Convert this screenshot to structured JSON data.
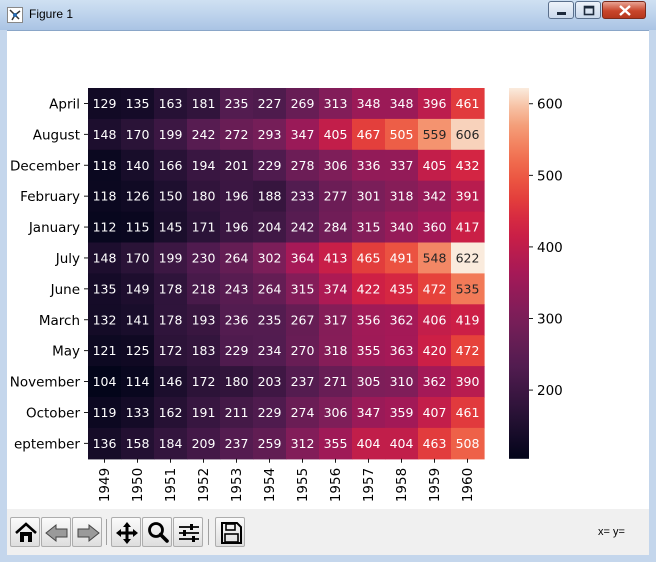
{
  "window": {
    "title": "Figure 1"
  },
  "toolbar": {
    "buttons": [
      {
        "name": "home",
        "icon": "home-icon"
      },
      {
        "name": "back",
        "icon": "back-arrow-icon"
      },
      {
        "name": "forward",
        "icon": "forward-arrow-icon"
      },
      {
        "name": "pan",
        "icon": "move-icon"
      },
      {
        "name": "zoom",
        "icon": "zoom-icon"
      },
      {
        "name": "configure-subplots",
        "icon": "sliders-icon"
      },
      {
        "name": "save",
        "icon": "save-icon"
      }
    ],
    "coords_x_label": "x=",
    "coords_y_label": "y="
  },
  "chart_data": {
    "type": "heatmap",
    "title": "",
    "xlabel": "",
    "ylabel": "",
    "x": [
      "1949",
      "1950",
      "1951",
      "1952",
      "1953",
      "1954",
      "1955",
      "1956",
      "1957",
      "1958",
      "1959",
      "1960"
    ],
    "y": [
      "April",
      "August",
      "December",
      "February",
      "January",
      "July",
      "June",
      "March",
      "May",
      "November",
      "October",
      "September"
    ],
    "y_tick_labels_shown": [
      "April",
      "August",
      "December",
      "February",
      "January",
      "July",
      "June",
      "March",
      "May",
      "November",
      "October",
      "eptember"
    ],
    "values": [
      [
        129,
        135,
        163,
        181,
        235,
        227,
        269,
        313,
        348,
        348,
        396,
        461
      ],
      [
        148,
        170,
        199,
        242,
        272,
        293,
        347,
        405,
        467,
        505,
        559,
        606
      ],
      [
        118,
        140,
        166,
        194,
        201,
        229,
        278,
        306,
        336,
        337,
        405,
        432
      ],
      [
        118,
        126,
        150,
        180,
        196,
        188,
        233,
        277,
        301,
        318,
        342,
        391
      ],
      [
        112,
        115,
        145,
        171,
        196,
        204,
        242,
        284,
        315,
        340,
        360,
        417
      ],
      [
        148,
        170,
        199,
        230,
        264,
        302,
        364,
        413,
        465,
        491,
        548,
        622
      ],
      [
        135,
        149,
        178,
        218,
        243,
        264,
        315,
        374,
        422,
        435,
        472,
        535
      ],
      [
        132,
        141,
        178,
        193,
        236,
        235,
        267,
        317,
        356,
        362,
        406,
        419
      ],
      [
        121,
        125,
        172,
        183,
        229,
        234,
        270,
        318,
        355,
        363,
        420,
        472
      ],
      [
        104,
        114,
        146,
        172,
        180,
        203,
        237,
        271,
        305,
        310,
        362,
        390
      ],
      [
        119,
        133,
        162,
        191,
        211,
        229,
        274,
        306,
        347,
        359,
        407,
        461
      ],
      [
        136,
        158,
        184,
        209,
        237,
        259,
        312,
        355,
        404,
        404,
        463,
        508
      ]
    ],
    "annotated": true,
    "colormap": "rocket",
    "colorbar": {
      "range": [
        104,
        622
      ],
      "ticks": [
        200,
        300,
        400,
        500,
        600
      ]
    }
  }
}
